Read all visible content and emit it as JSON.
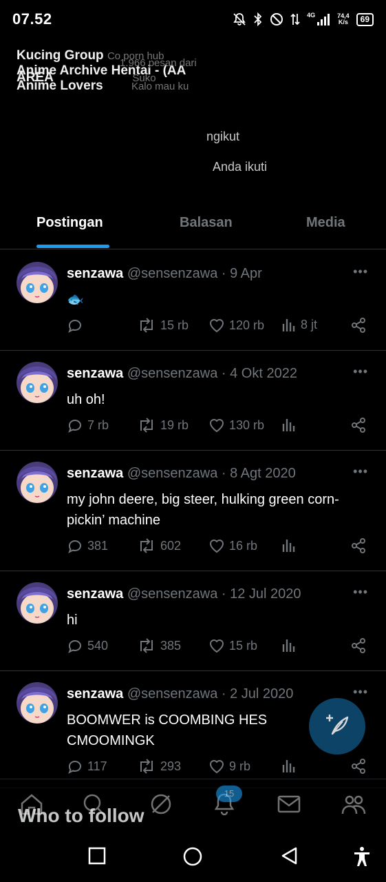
{
  "status_bar": {
    "time": "07.52",
    "network_type": "4G",
    "speed_value": "74,4",
    "speed_unit": "K/s",
    "battery": "69"
  },
  "notification": {
    "line1_title": "Kucing Group",
    "line1_sub": "Co porn hub",
    "line2_title": "Anime Archive Hentai - (AA",
    "line2_sub": "1.966 pesan dari",
    "line3_title": "AREA",
    "line3_sub": "Suko",
    "line4_title": "Anime Lovers",
    "line4_sub": "Kalo mau ku"
  },
  "profile": {
    "following_label": "ngikut",
    "followed_by_label": "Anda ikuti"
  },
  "tabs": [
    {
      "label": "Postingan",
      "active": true
    },
    {
      "label": "Balasan",
      "active": false
    },
    {
      "label": "Media",
      "active": false
    }
  ],
  "posts": [
    {
      "name": "senzawa",
      "handle": "@sensenzawa",
      "date": "9 Apr",
      "text": "🐟",
      "replies": "",
      "reposts": "15 rb",
      "likes": "120 rb",
      "views": "8 jt"
    },
    {
      "name": "senzawa",
      "handle": "@sensenzawa",
      "date": "4 Okt 2022",
      "text": "uh oh!",
      "replies": "7 rb",
      "reposts": "19 rb",
      "likes": "130 rb",
      "views": ""
    },
    {
      "name": "senzawa",
      "handle": "@sensenzawa",
      "date": "8 Agt 2020",
      "text": "my john deere, big steer, hulking green corn-pickin’ machine",
      "replies": "381",
      "reposts": "602",
      "likes": "16 rb",
      "views": ""
    },
    {
      "name": "senzawa",
      "handle": "@sensenzawa",
      "date": "12 Jul 2020",
      "text": "hi",
      "replies": "540",
      "reposts": "385",
      "likes": "15 rb",
      "views": ""
    },
    {
      "name": "senzawa",
      "handle": "@sensenzawa",
      "date": "2 Jul 2020",
      "text": "BOOMWER is COOMBING HES CMOOMINGK",
      "replies": "117",
      "reposts": "293",
      "likes": "9 rb",
      "views": ""
    }
  ],
  "separator": "·",
  "more_label": "•••",
  "bottom_nav": {
    "notifications_badge": "15",
    "who_to_follow": "Who to follow"
  },
  "colors": {
    "accent": "#1d9bf0",
    "background": "#000000",
    "muted": "#71767b",
    "divider": "#2f3336"
  }
}
